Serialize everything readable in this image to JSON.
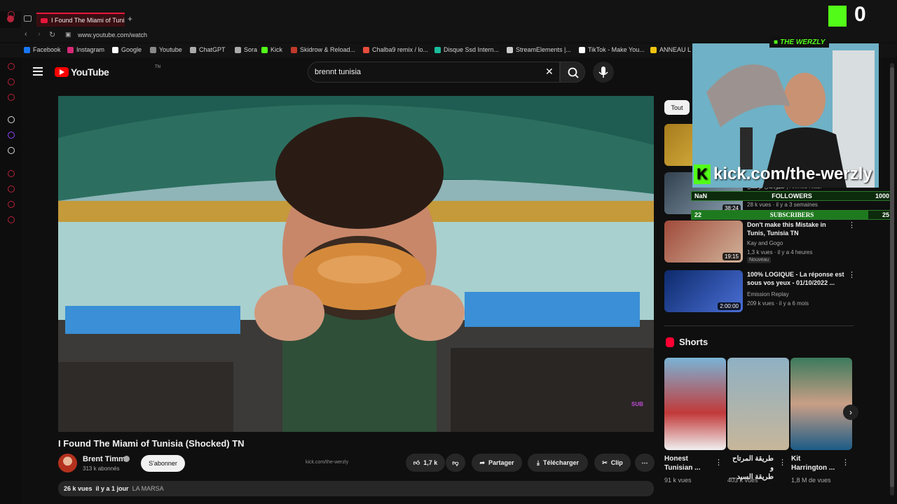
{
  "browser": {
    "tab_title": "I Found The Miami of Tunisia",
    "url": "www.youtube.com/watch"
  },
  "bookmarks": [
    {
      "label": "Facebook",
      "color": "#1877f2"
    },
    {
      "label": "Instagram",
      "color": "#d62976"
    },
    {
      "label": "Google",
      "color": "#ffffff"
    },
    {
      "label": "Youtube",
      "color": "#888888"
    },
    {
      "label": "ChatGPT",
      "color": "#aaaaaa"
    },
    {
      "label": "Sora",
      "color": "#aaaaaa"
    },
    {
      "label": "Kick",
      "color": "#53fc18"
    },
    {
      "label": "Skidrow & Reload...",
      "color": "#c0392b"
    },
    {
      "label": "Chalba9 remix / lo...",
      "color": "#e74c3c"
    },
    {
      "label": "Disque Ssd Intern...",
      "color": "#1abc9c"
    },
    {
      "label": "StreamElements |...",
      "color": "#cccccc"
    },
    {
      "label": "TikTok - Make You...",
      "color": "#ffffff"
    },
    {
      "label": "ANNEAU L",
      "color": "#f1c40f"
    }
  ],
  "youtube": {
    "logo_text": "YouTube",
    "logo_sup": "TN",
    "search_query": "brennt tunisia"
  },
  "video": {
    "title": "I Found The Miami of Tunisia (Shocked) 🇹🇳",
    "title_display": "I Found The Miami of Tunisia (Shocked) TN",
    "channel": "Brent Timm",
    "subscribers": "313 k abonnés",
    "subscribe_label": "S'abonner",
    "overlay_text": "kick.com/the-werzly",
    "likes": "1,7 k",
    "share_label": "Partager",
    "download_label": "Télécharger",
    "clip_label": "Clip",
    "views": "26 k vues",
    "age": "il y a 1 jour",
    "place": "LA MARSA",
    "sub_badge": "SUB"
  },
  "sidebar": {
    "chip": "Tout",
    "recs": [
      {
        "title": "",
        "channel": "",
        "meta": "",
        "duration": ""
      },
      {
        "title": "سيودمان تونسي | Ahmed Riabi",
        "channel": "",
        "meta": "28 k vues · il y a 3 semaines",
        "duration": "38:24"
      },
      {
        "title": "Don't make this Mistake in Tunis, Tunisia TN",
        "channel": "Kay and Gogo",
        "meta": "1,3 k vues · il y a 4 heures",
        "duration": "19:15",
        "badge": "Nouveau"
      },
      {
        "title": "100% LOGIQUE - La réponse est sous vos yeux - 01/10/2022 ...",
        "channel": "Emission Replay",
        "meta": "209 k vues · il y a 6 mois",
        "duration": "2:00:00"
      }
    ],
    "shorts_label": "Shorts",
    "shorts": [
      {
        "title": "Honest\nTunisian ...",
        "views": "91 k vues"
      },
      {
        "title": "طريقة المرتاح و\nطريقة السيد ...",
        "views": "403 k vues"
      },
      {
        "title": "Kit\nHarrington ...",
        "views": "1,8 M de vues"
      }
    ]
  },
  "stream_overlay": {
    "kick_count": "0",
    "cam_label": "THE WERZLY",
    "kick_url": "kick.com/the-werzly",
    "followers": {
      "left": "NaN",
      "label": "FOLLOWERS",
      "goal": "1000",
      "progress": 0
    },
    "subscribers": {
      "left": "22",
      "label": "SUBSCRIBERS",
      "goal": "25",
      "progress": 0.88
    }
  },
  "colors": {
    "accent": "#ff0000",
    "kick_green": "#53fc18",
    "opera_red": "#e8173b"
  }
}
